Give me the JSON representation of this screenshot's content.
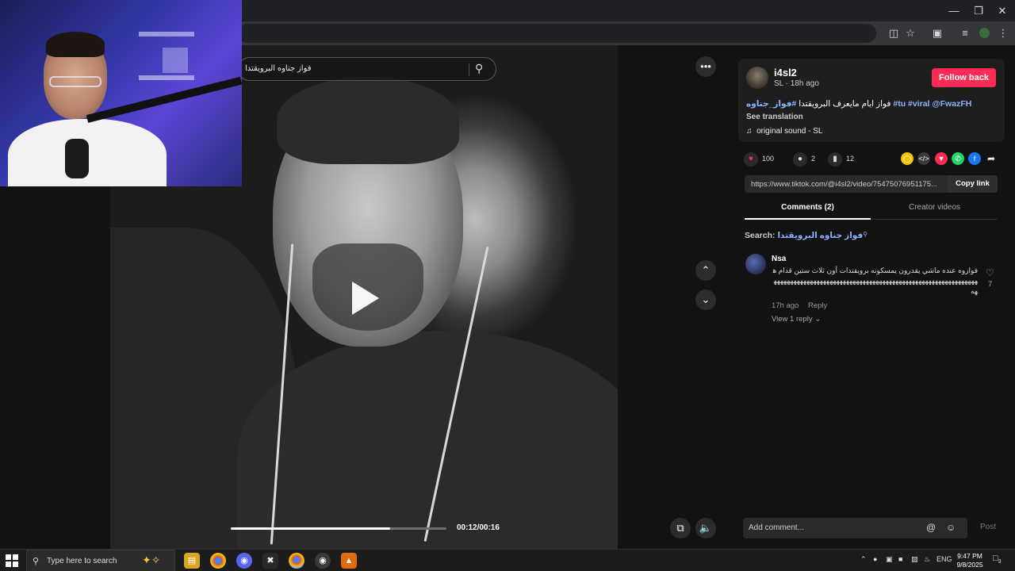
{
  "search": {
    "query": "فواز جناوه البرويقتدا"
  },
  "video": {
    "progress": 0.74,
    "time": "00:12/00:16"
  },
  "author": {
    "username": "i4sl2",
    "meta": "SL · 18h ago",
    "follow_label": "Follow back",
    "caption_text": "فواز ايام مايعرف البرويقتدا",
    "caption_tags": [
      "#فواز_جناوه",
      "#tu",
      "#viral",
      "@FwazFH"
    ],
    "see_translation": "See translation",
    "sound": "original sound - SL"
  },
  "stats": {
    "likes": "100",
    "comments": "2",
    "saves": "12"
  },
  "link": {
    "url": "https://www.tiktok.com/@i4sl2/video/75475076951175...",
    "copy_label": "Copy link"
  },
  "tabs": [
    {
      "label": "Comments (2)",
      "active": true
    },
    {
      "label": "Creator videos",
      "active": false
    }
  ],
  "comment_search": {
    "label": "Search:",
    "query": "فواز جناوه البرويقتدا"
  },
  "comments": [
    {
      "author": "Nsa",
      "text": "فوازوه عنده ماشي يقدرون يمسكونه برويقتدات أون ثلاث ستين قدام ههههههههههههههههههههههههههههههههههههههههههههههههههههههههههههههههه",
      "time": "17h ago",
      "reply_label": "Reply",
      "view_replies": "View 1 reply",
      "likes": "7"
    }
  ],
  "composer": {
    "placeholder": "Add comment...",
    "post_label": "Post"
  },
  "taskbar": {
    "search_placeholder": "Type here to search",
    "lang": "ENG",
    "time": "9:47 PM",
    "date": "9/8/2025",
    "notif_count": "3"
  },
  "colors": {
    "accent": "#fe2c55",
    "link": "#8ab4ff"
  }
}
